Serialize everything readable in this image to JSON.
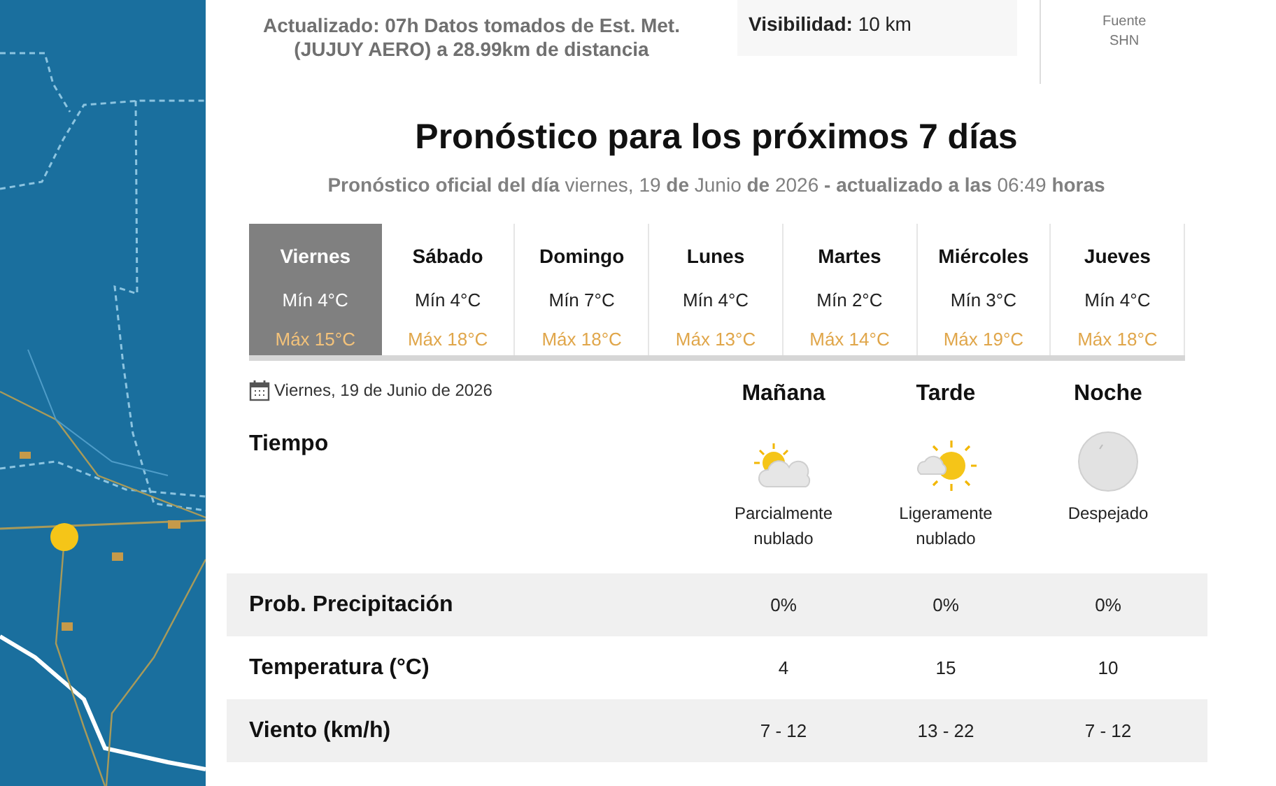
{
  "station": {
    "updated": "Actualizado: 07h Datos tomados de Est. Met. (JUJUY AERO) a 28.99km de distancia",
    "visibility": "**Visibilidad:** 10 km",
    "source_label": "Fuente",
    "source": "SHN"
  },
  "forecast": {
    "title": "Pronóstico para los próximos 7 días",
    "subtitle": "**Pronóstico oficial del día** viernes, 19 **de** Junio **de** 2026 **- actualizado a las** 06:49 **horas**"
  },
  "days": [
    {
      "name": "Viernes",
      "min": "Mín 4°C",
      "max": "Máx 15°C",
      "selected": true
    },
    {
      "name": "Sábado",
      "min": "Mín 4°C",
      "max": "Máx 18°C",
      "selected": false
    },
    {
      "name": "Domingo",
      "min": "Mín 7°C",
      "max": "Máx 18°C",
      "selected": false
    },
    {
      "name": "Lunes",
      "min": "Mín 4°C",
      "max": "Máx 13°C",
      "selected": false
    },
    {
      "name": "Martes",
      "min": "Mín 2°C",
      "max": "Máx 14°C",
      "selected": false
    },
    {
      "name": "Miércoles",
      "min": "Mín 3°C",
      "max": "Máx 19°C",
      "selected": false
    },
    {
      "name": "Jueves",
      "min": "Mín 4°C",
      "max": "Máx 18°C",
      "selected": false
    }
  ],
  "detail": {
    "date": "Viernes, 19 de Junio de 2026",
    "weather_label": "Tiempo",
    "periods": [
      {
        "name": "Mañana",
        "kind": "partly_cloudy",
        "condition": "Parcialmente nublado"
      },
      {
        "name": "Tarde",
        "kind": "mostly_sunny",
        "condition": "Ligeramente nublado"
      },
      {
        "name": "Noche",
        "kind": "clear_night",
        "condition": "Despejado"
      }
    ],
    "rows": [
      {
        "label": "Prob. Precipitación",
        "values": [
          "0%",
          "0%",
          "0%"
        ]
      },
      {
        "label": "Temperatura (°C)",
        "values": [
          "4",
          "15",
          "10"
        ]
      },
      {
        "label": "Viento (km/h)",
        "values": [
          "7 - 12",
          "13 - 22",
          "7 - 12"
        ]
      }
    ]
  }
}
